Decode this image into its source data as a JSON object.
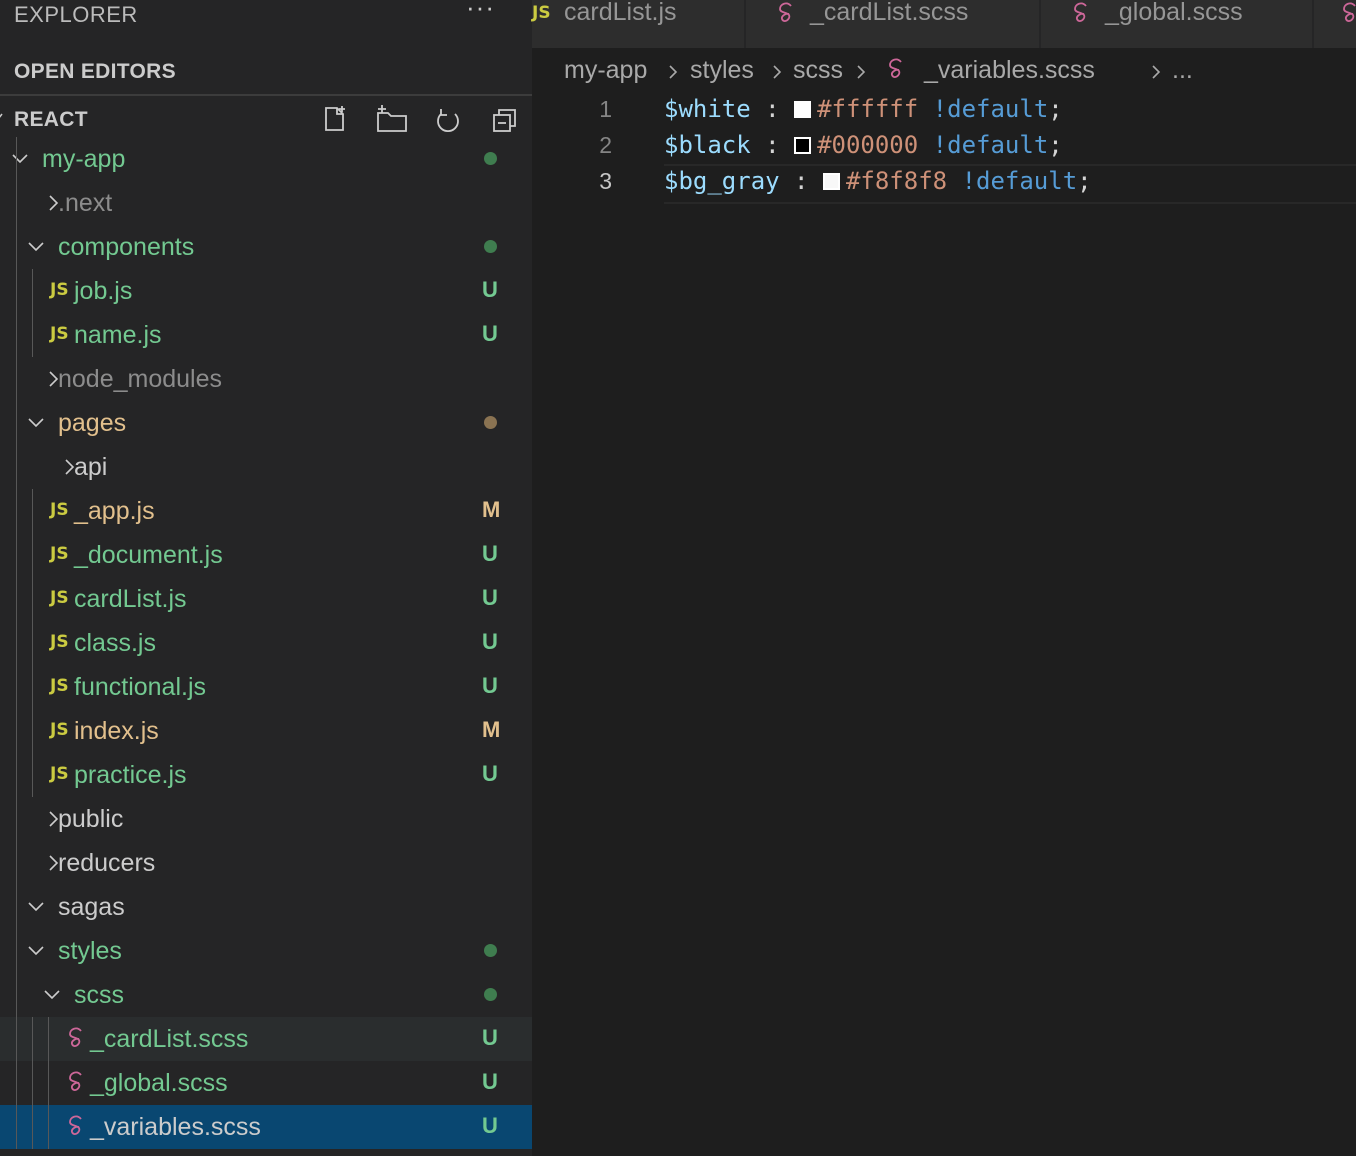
{
  "sidebar": {
    "title": "EXPLORER",
    "more": "···",
    "open_editors": "OPEN EDITORS",
    "workspace": "REACT",
    "actions": [
      "new-file-icon",
      "new-folder-icon",
      "refresh-icon",
      "collapse-all-icon"
    ]
  },
  "tree": [
    {
      "label": "my-app",
      "type": "folder",
      "open": true,
      "depth": 0,
      "color": "green",
      "decoration": "dot-green"
    },
    {
      "label": ".next",
      "type": "folder",
      "open": false,
      "depth": 1,
      "color": "gray",
      "decoration": ""
    },
    {
      "label": "components",
      "type": "folder",
      "open": true,
      "depth": 1,
      "color": "green",
      "decoration": "dot-green"
    },
    {
      "label": "job.js",
      "type": "js",
      "depth": 2,
      "color": "green",
      "decoration": "U"
    },
    {
      "label": "name.js",
      "type": "js",
      "depth": 2,
      "color": "green",
      "decoration": "U"
    },
    {
      "label": "node_modules",
      "type": "folder",
      "open": false,
      "depth": 1,
      "color": "gray",
      "decoration": ""
    },
    {
      "label": "pages",
      "type": "folder",
      "open": true,
      "depth": 1,
      "color": "yellow",
      "decoration": "dot-yellow"
    },
    {
      "label": "api",
      "type": "folder",
      "open": false,
      "depth": 2,
      "color": "white",
      "decoration": ""
    },
    {
      "label": "_app.js",
      "type": "js",
      "depth": 2,
      "color": "yellow",
      "decoration": "M"
    },
    {
      "label": "_document.js",
      "type": "js",
      "depth": 2,
      "color": "green",
      "decoration": "U"
    },
    {
      "label": "cardList.js",
      "type": "js",
      "depth": 2,
      "color": "green",
      "decoration": "U"
    },
    {
      "label": "class.js",
      "type": "js",
      "depth": 2,
      "color": "green",
      "decoration": "U"
    },
    {
      "label": "functional.js",
      "type": "js",
      "depth": 2,
      "color": "green",
      "decoration": "U"
    },
    {
      "label": "index.js",
      "type": "js",
      "depth": 2,
      "color": "yellow",
      "decoration": "M"
    },
    {
      "label": "practice.js",
      "type": "js",
      "depth": 2,
      "color": "green",
      "decoration": "U"
    },
    {
      "label": "public",
      "type": "folder",
      "open": false,
      "depth": 1,
      "color": "white",
      "decoration": ""
    },
    {
      "label": "reducers",
      "type": "folder",
      "open": false,
      "depth": 1,
      "color": "white",
      "decoration": ""
    },
    {
      "label": "sagas",
      "type": "folder",
      "open": true,
      "depth": 1,
      "color": "white",
      "decoration": ""
    },
    {
      "label": "styles",
      "type": "folder",
      "open": true,
      "depth": 1,
      "color": "green",
      "decoration": "dot-green"
    },
    {
      "label": "scss",
      "type": "folder",
      "open": true,
      "depth": 2,
      "color": "green",
      "decoration": "dot-green"
    },
    {
      "label": "_cardList.scss",
      "type": "scss",
      "depth": 3,
      "color": "green",
      "decoration": "U",
      "state": "hover"
    },
    {
      "label": "_global.scss",
      "type": "scss",
      "depth": 3,
      "color": "green",
      "decoration": "U"
    },
    {
      "label": "_variables.scss",
      "type": "scss",
      "depth": 3,
      "color": "white",
      "decoration": "U",
      "state": "selected"
    }
  ],
  "tabs": [
    {
      "label": "cardList.js",
      "type": "js"
    },
    {
      "label": "_cardList.scss",
      "type": "scss"
    },
    {
      "label": "_global.scss",
      "type": "scss"
    },
    {
      "label": "",
      "type": "scss"
    }
  ],
  "breadcrumb": [
    "my-app",
    "styles",
    "scss",
    "_variables.scss",
    "..."
  ],
  "code": [
    {
      "num": "1",
      "var": "$white",
      "sep": " : ",
      "swatch": "#ffffff",
      "hex": "#ffffff",
      "imp": "!default",
      "end": ";"
    },
    {
      "num": "2",
      "var": "$black",
      "sep": " : ",
      "swatch": "#000000",
      "hex": "#000000",
      "imp": "!default",
      "end": ";"
    },
    {
      "num": "3",
      "var": "$bg_gray",
      "sep": " : ",
      "swatch": "#f8f8f8",
      "hex": "#f8f8f8",
      "imp": "!default",
      "end": ";",
      "current": true
    }
  ],
  "colors": {
    "green": "#73c991",
    "yellow": "#e2c08d",
    "gray": "#8c8c8c",
    "white": "#cccccc",
    "dot_green": "#3f7d4f",
    "dot_yellow": "#8a7352",
    "sass": "#cd6799",
    "selected_bg": "#094771"
  }
}
